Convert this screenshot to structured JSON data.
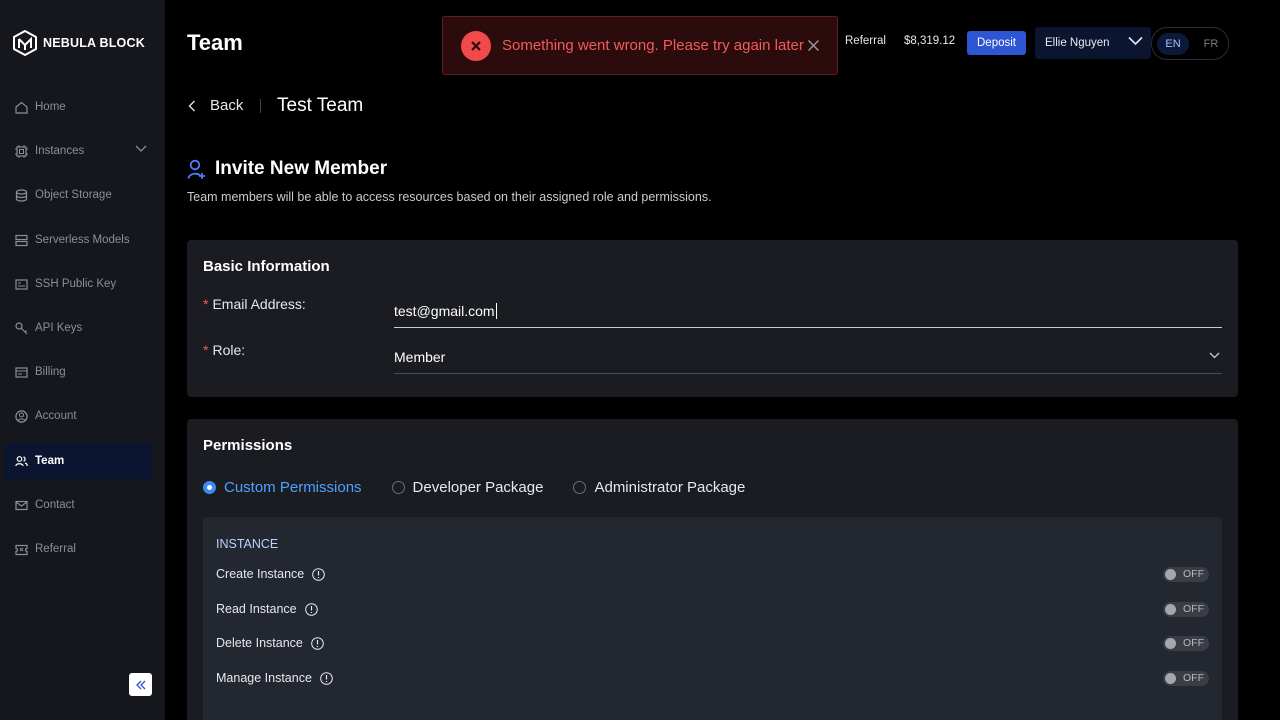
{
  "brand": {
    "name": "NEBULA BLOCK"
  },
  "sidebar": {
    "items": [
      {
        "label": "Home",
        "icon": "home-icon"
      },
      {
        "label": "Instances",
        "icon": "chip-icon"
      },
      {
        "label": "Object Storage",
        "icon": "database-icon"
      },
      {
        "label": "Serverless Models",
        "icon": "server-icon"
      },
      {
        "label": "SSH Public Key",
        "icon": "key-card-icon"
      },
      {
        "label": "API Keys",
        "icon": "key-icon"
      },
      {
        "label": "Billing",
        "icon": "billing-icon"
      },
      {
        "label": "Account",
        "icon": "account-icon"
      },
      {
        "label": "Team",
        "icon": "team-icon",
        "active": true
      },
      {
        "label": "Contact",
        "icon": "mail-icon"
      },
      {
        "label": "Referral",
        "icon": "ticket-icon"
      }
    ]
  },
  "header": {
    "title": "Team",
    "referral": "Referral",
    "balance": "$8,319.12",
    "deposit": "Deposit",
    "user": "Ellie Nguyen",
    "languages": [
      "EN",
      "FR"
    ],
    "active_language": "EN"
  },
  "toast": {
    "message": "Something went wrong. Please try again later"
  },
  "breadcrumb": {
    "back": "Back",
    "team_name": "Test Team"
  },
  "invite": {
    "title": "Invite New Member",
    "description": "Team members will be able to access resources based on their assigned role and permissions."
  },
  "basic_info": {
    "title": "Basic Information",
    "email_label": "Email Address:",
    "email_value": "test@gmail.com",
    "role_label": "Role:",
    "role_value": "Member",
    "required_mark": "*"
  },
  "permissions": {
    "title": "Permissions",
    "options": [
      "Custom Permissions",
      "Developer Package",
      "Administrator Package"
    ],
    "selected": "Custom Permissions",
    "group": "INSTANCE",
    "rows": [
      {
        "label": "Create Instance",
        "state": "OFF"
      },
      {
        "label": "Read Instance",
        "state": "OFF"
      },
      {
        "label": "Delete Instance",
        "state": "OFF"
      },
      {
        "label": "Manage Instance",
        "state": "OFF"
      }
    ]
  },
  "colors": {
    "accent": "#2e55d4",
    "error": "#f04a4a",
    "active_nav_bg": "#0c1530",
    "link_blue": "#4ea1ff"
  }
}
